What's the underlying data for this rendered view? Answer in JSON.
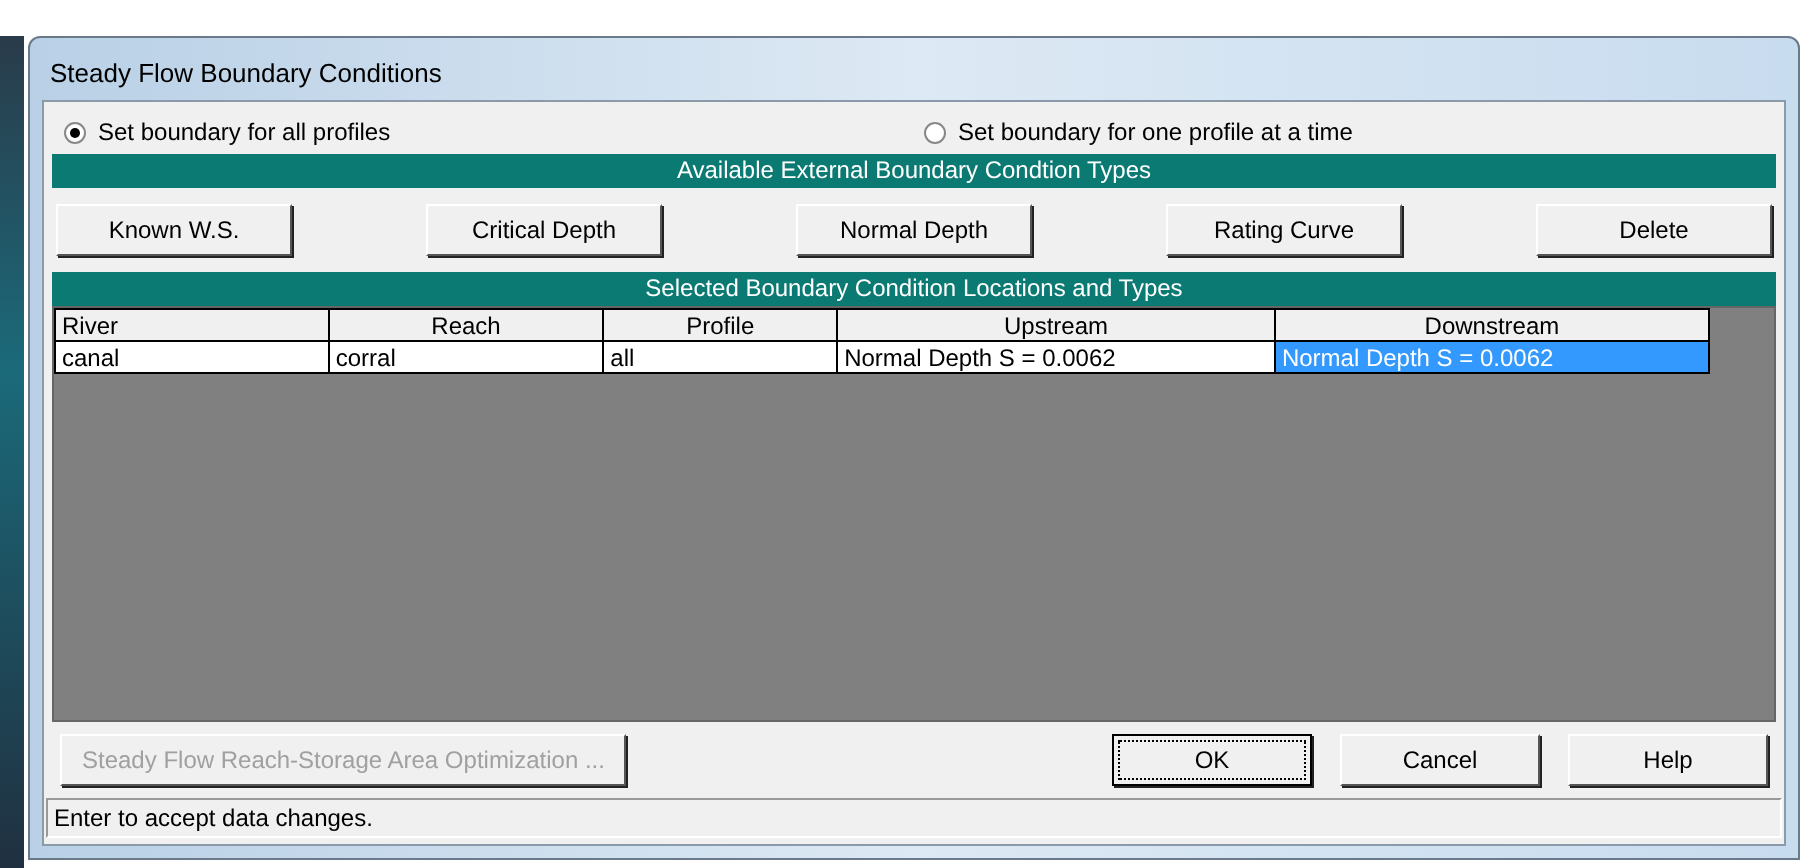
{
  "window": {
    "title": "Steady Flow Boundary Conditions"
  },
  "options": [
    {
      "label": "Set boundary for all profiles",
      "selected": true
    },
    {
      "label": "Set boundary for one profile at a time",
      "selected": false
    }
  ],
  "types_header": "Available External Boundary Condtion Types",
  "type_buttons": [
    "Known W.S.",
    "Critical Depth",
    "Normal Depth",
    "Rating Curve",
    "Delete"
  ],
  "table": {
    "title": "Selected Boundary Condition Locations and Types",
    "columns": [
      "River",
      "Reach",
      "Profile",
      "Upstream",
      "Downstream"
    ],
    "rows": [
      {
        "cells": [
          {
            "text": "canal",
            "selected": false
          },
          {
            "text": "corral",
            "selected": false
          },
          {
            "text": "all",
            "selected": false
          },
          {
            "text": "Normal Depth S = 0.0062",
            "selected": false
          },
          {
            "text": "Normal Depth S = 0.0062",
            "selected": true
          }
        ]
      }
    ]
  },
  "buttons": [
    {
      "label": "Steady Flow Reach-Storage Area Optimization ...",
      "disabled": true,
      "focused": false
    },
    {
      "label": "OK",
      "disabled": false,
      "focused": true
    },
    {
      "label": "Cancel",
      "disabled": false,
      "focused": false
    },
    {
      "label": "Help",
      "disabled": false,
      "focused": false
    }
  ],
  "status_bar": "Enter to accept data changes."
}
